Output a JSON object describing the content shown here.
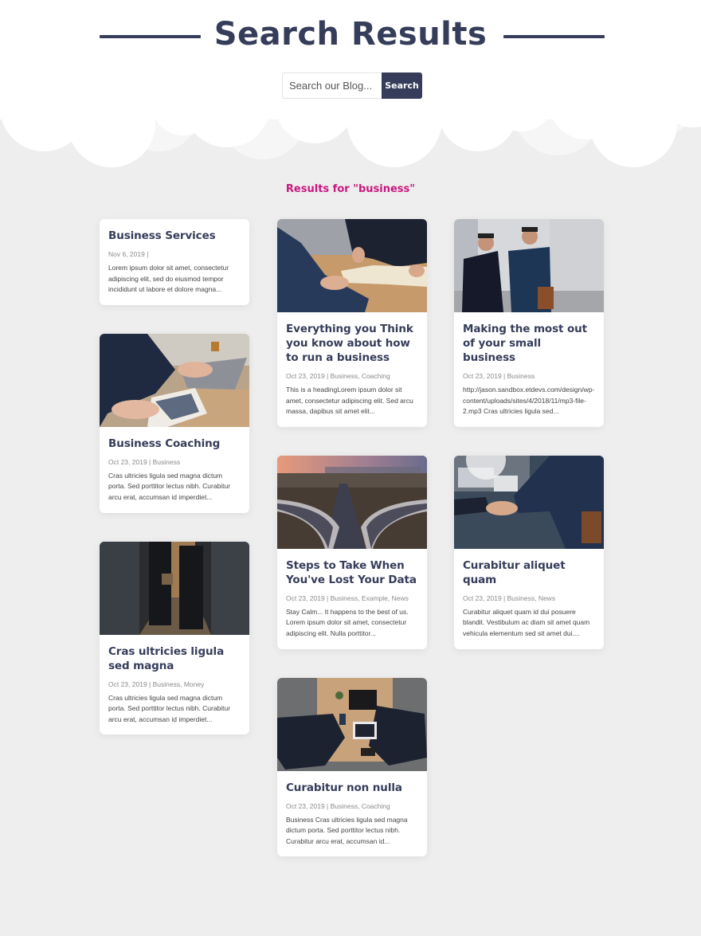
{
  "header": {
    "title": "Search Results",
    "search": {
      "placeholder": "Search our Blog...",
      "value": "",
      "button_label": "Search"
    }
  },
  "results_label": "Results for \"business\"",
  "colors": {
    "primary": "#363d5a",
    "accent": "#c9177e",
    "background": "#eeeeee"
  },
  "columns": [
    {
      "posts": [
        {
          "title": "Business Services",
          "image": null,
          "meta": "Nov 6, 2019 |",
          "excerpt": "Lorem ipsum dolor sit amet, consectetur adipiscing elit, sed do eiusmod tempor incididunt ut labore et dolore magna..."
        },
        {
          "title": "Business Coaching",
          "image": "hands-laptop-tablet-photo",
          "meta": "Oct 23, 2019 | Business",
          "excerpt": "Cras ultricies ligula sed magna dictum porta. Sed porttitor lectus nibh. Curabitur arcu erat, accumsan id imperdiet..."
        },
        {
          "title": "Cras ultricies ligula sed magna",
          "image": "businessmen-hallway-photo",
          "meta": "Oct 23, 2019 | Business, Money",
          "excerpt": "Cras ultricies ligula sed magna dictum porta. Sed porttitor lectus nibh. Curabitur arcu erat, accumsan id imperdiet..."
        }
      ]
    },
    {
      "posts": [
        {
          "title": "Everything you Think you know about how to run a business",
          "image": "desk-notebook-photo",
          "meta": "Oct 23, 2019 | Business, Coaching",
          "excerpt": "This is a headingLorem ipsum dolor sit amet, consectetur adipiscing elit. Sed arcu massa, dapibus sit amet elit..."
        },
        {
          "title": "Steps to Take When You've Lost Your Data",
          "image": "highway-interchange-photo",
          "meta": "Oct 23, 2019 | Business, Example, News",
          "excerpt": "Stay Calm... It happens to the best of us. Lorem ipsum dolor sit amet, consectetur adipiscing elit. Nulla porttitor..."
        },
        {
          "title": "Curabitur non nulla",
          "image": "meeting-table-overhead-photo",
          "meta": "Oct 23, 2019 | Business, Coaching",
          "excerpt": "Business Cras ultricies ligula sed magna dictum porta. Sed porttitor lectus nibh. Curabitur arcu erat, accumsan id..."
        }
      ]
    },
    {
      "posts": [
        {
          "title": "Making the most out of your small business",
          "image": "two-businessmen-street-photo",
          "meta": "Oct 23, 2019 | Business",
          "excerpt": "http://jason.sandbox.etdevs.com/design/wp-content/uploads/sites/4/2018/11/mp3-file-2.mp3 Cras ultricies ligula sed..."
        },
        {
          "title": "Curabitur aliquet quam",
          "image": "handshake-photo",
          "meta": "Oct 23, 2019 | Business, News",
          "excerpt": "Curabitur aliquet quam id dui posuere blandit. Vestibulum ac diam sit amet quam vehicula elementum sed sit amet dui...."
        }
      ]
    }
  ]
}
